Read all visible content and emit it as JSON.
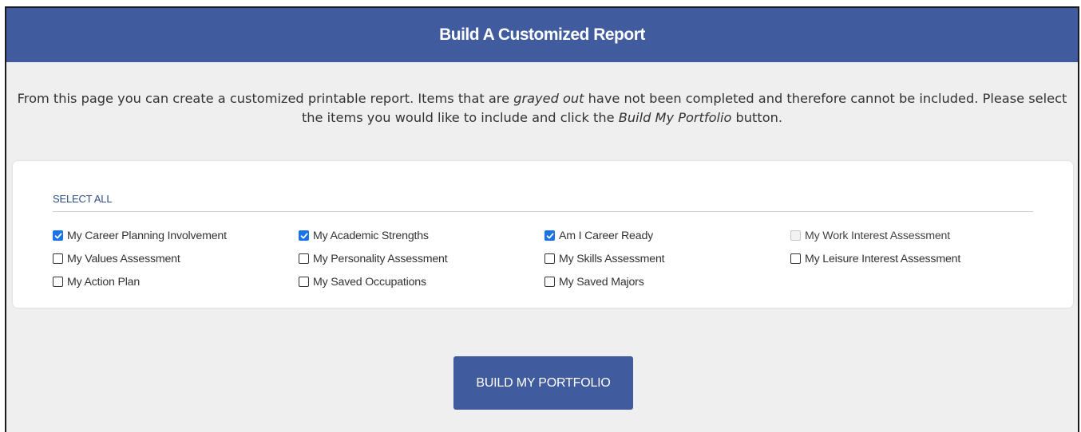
{
  "header": {
    "title": "Build A Customized Report"
  },
  "intro": {
    "part1": "From this page you can create a customized printable report. Items that are ",
    "em1": "grayed out",
    "part2": " have not been completed and therefore cannot be included. Please select the items you would like to include and click the ",
    "em2": "Build My Portfolio",
    "part3": " button."
  },
  "select_all_label": "SELECT ALL",
  "items": [
    [
      {
        "label": "My Career Planning Involvement",
        "checked": true,
        "disabled": false
      },
      {
        "label": "My Academic Strengths",
        "checked": true,
        "disabled": false
      },
      {
        "label": "Am I Career Ready",
        "checked": true,
        "disabled": false
      },
      {
        "label": "My Work Interest Assessment",
        "checked": false,
        "disabled": true
      }
    ],
    [
      {
        "label": "My Values Assessment",
        "checked": false,
        "disabled": false
      },
      {
        "label": "My Personality Assessment",
        "checked": false,
        "disabled": false
      },
      {
        "label": "My Skills Assessment",
        "checked": false,
        "disabled": false
      },
      {
        "label": "My Leisure Interest Assessment",
        "checked": false,
        "disabled": false
      }
    ],
    [
      {
        "label": "My Action Plan",
        "checked": false,
        "disabled": false
      },
      {
        "label": "My Saved Occupations",
        "checked": false,
        "disabled": false
      },
      {
        "label": "My Saved Majors",
        "checked": false,
        "disabled": false
      }
    ]
  ],
  "build_button_label": "BUILD MY PORTFOLIO",
  "colors": {
    "header_bg": "#405b9e",
    "button_bg": "#405b9e",
    "checkbox_checked": "#1a73e8",
    "select_all_link": "#2e4f8c"
  }
}
